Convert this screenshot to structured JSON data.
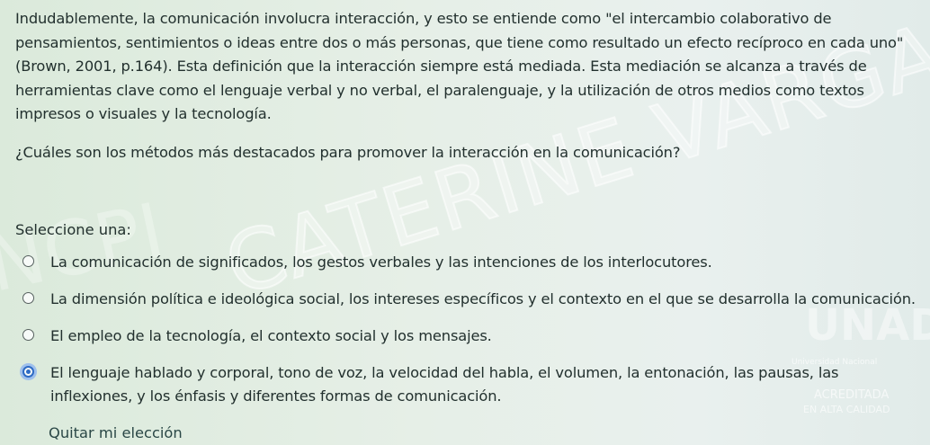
{
  "question_text": {
    "paragraph": "Indudablemente, la comunicación involucra interacción, y esto se entiende como \"el intercambio colaborativo de pensamientos, sentimientos o ideas entre dos o más personas, que tiene como resultado un efecto recíproco en cada uno\" (Brown, 2001, p.164). Esta definición que la interacción siempre está mediada. Esta mediación se alcanza a través de herramientas clave como el lenguaje verbal y no verbal, el paralenguaje, y la utilización de otros medios como textos impresos o visuales y la tecnología.",
    "question": "¿Cuáles son los métodos más destacados para promover la interacción en la comunicación?"
  },
  "answer": {
    "select_label": "Seleccione una:",
    "options": [
      {
        "label": "La comunicación de significados, los gestos verbales y las intenciones de los interlocutores.",
        "selected": false
      },
      {
        "label": "La dimensión política e ideológica social, los intereses específicos y el contexto en el que se desarrolla la comunicación.",
        "selected": false
      },
      {
        "label": "El empleo de la tecnología, el contexto social y los mensajes.",
        "selected": false
      },
      {
        "label": "El lenguaje hablado y corporal, tono de voz, la velocidad del habla, el volumen, la entonación, las pausas, las inflexiones, y los énfasis y diferentes formas de comunicación.",
        "selected": true
      }
    ],
    "clear_label": "Quitar mi elección"
  },
  "watermark": {
    "main_text": "CATERINE VARGAS",
    "left_text": "NCPI",
    "logo_text": "UNAD",
    "logo_subtitle": "Universidad Nacional",
    "stamp_text": "ACREDITADA",
    "stamp_subtitle": "EN ALTA CALIDAD"
  },
  "colors": {
    "background": "#e6efe7",
    "text": "#22302e",
    "selected_radio": "#2e6bc4"
  }
}
